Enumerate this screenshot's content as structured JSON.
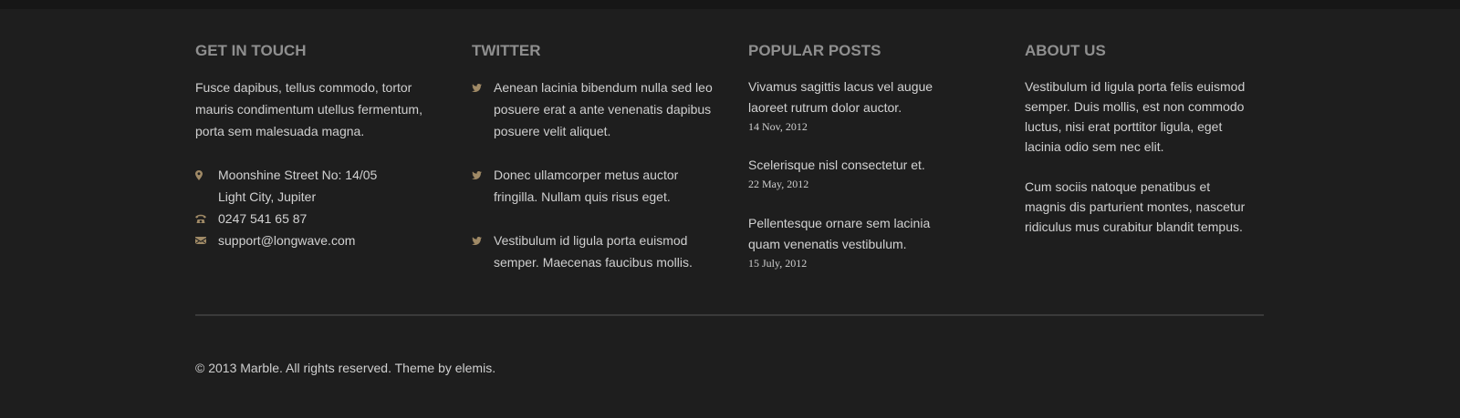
{
  "colors": {
    "background": "#1e1e1e",
    "heading": "#8f8f8f",
    "text": "#cfcfcf",
    "icon_accent": "#a08a66",
    "divider": "#3a3a3a"
  },
  "get_in_touch": {
    "title": "GET IN TOUCH",
    "intro": "Fusce dapibus, tellus commodo, tortor mauris condimentum utellus fermentum, porta sem malesuada magna.",
    "address_line1": "Moonshine Street No: 14/05",
    "address_line2": "Light City, Jupiter",
    "phone": "0247 541 65 87",
    "email": "support@longwave.com",
    "icons": [
      "map-pin-icon",
      "phone-icon",
      "envelope-icon"
    ]
  },
  "twitter": {
    "title": "TWITTER",
    "icon": "twitter-bird-icon",
    "tweets": [
      "Aenean lacinia bibendum nulla sed leo posuere erat a ante venenatis dapibus posuere velit aliquet.",
      "Donec ullamcorper metus auctor fringilla. Nullam quis risus eget.",
      "Vestibulum id ligula porta  euismod semper. Maecenas faucibus mollis."
    ]
  },
  "popular_posts": {
    "title": "POPULAR POSTS",
    "posts": [
      {
        "title": "Vivamus sagittis lacus vel augue laoreet rutrum dolor auctor.",
        "date": "14 Nov, 2012"
      },
      {
        "title": "Scelerisque nisl consectetur et.",
        "date": "22 May, 2012"
      },
      {
        "title": "Pellentesque ornare sem lacinia quam venenatis vestibulum.",
        "date": "15 July, 2012"
      }
    ]
  },
  "about_us": {
    "title": "ABOUT US",
    "paragraphs": [
      "Vestibulum id ligula porta felis euismod semper. Duis mollis, est non commodo luctus, nisi erat porttitor ligula, eget lacinia odio sem nec elit.",
      "Cum sociis natoque penatibus et magnis dis parturient montes, nascetur ridiculus mus curabitur blandit tempus."
    ]
  },
  "footer": {
    "copyright": "© 2013 Marble. All rights reserved. Theme by elemis."
  }
}
